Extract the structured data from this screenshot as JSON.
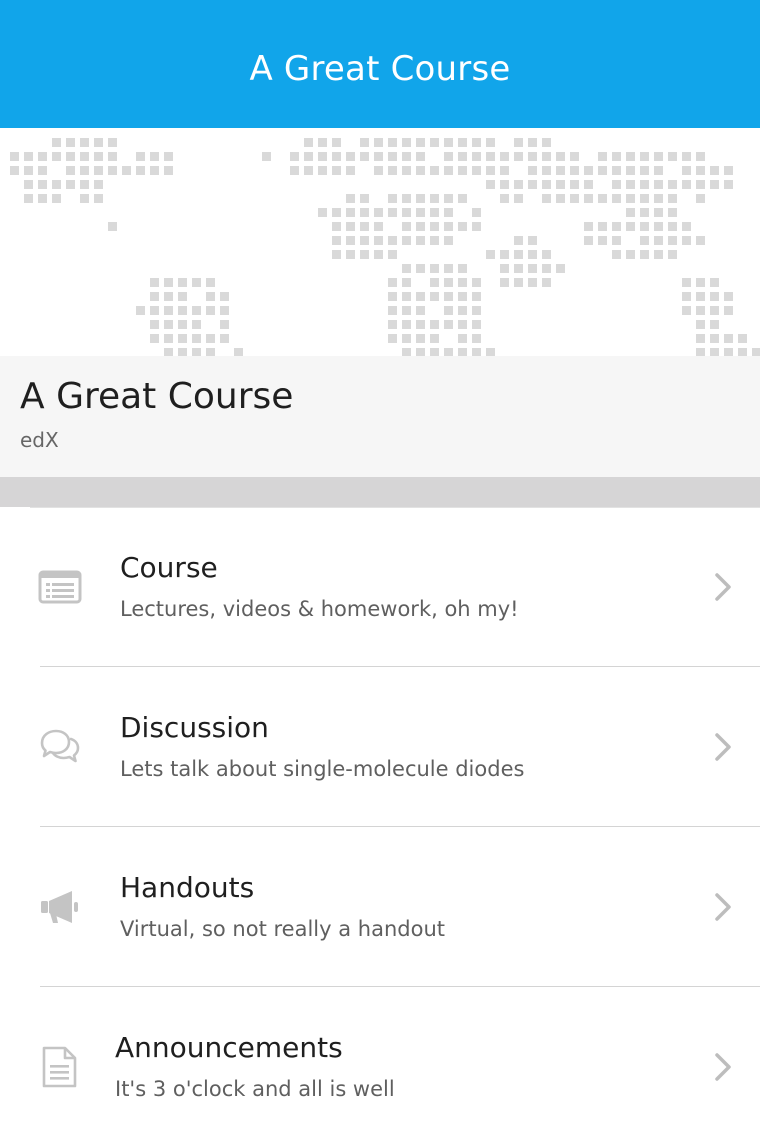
{
  "nav": {
    "title": "A Great Course"
  },
  "hero": {
    "image": "world-map-dots",
    "dot_color": "#d9d9d9"
  },
  "course": {
    "title": "A Great Course",
    "org": "edX"
  },
  "menu": {
    "items": [
      {
        "title": "Course",
        "subtitle": "Lectures, videos & homework, oh my!",
        "icon": "list-icon"
      },
      {
        "title": "Discussion",
        "subtitle": "Lets talk about single-molecule diodes",
        "icon": "chat-bubbles-icon"
      },
      {
        "title": "Handouts",
        "subtitle": "Virtual, so not really a handout",
        "icon": "megaphone-icon"
      },
      {
        "title": "Announcements",
        "subtitle": "It's 3 o'clock and all is well",
        "icon": "document-icon"
      }
    ]
  },
  "colors": {
    "nav_background": "#11a5ea",
    "header_background": "#f6f6f6",
    "separator": "#d6d5d6",
    "icon_gray": "#c4c4c4",
    "chevron_gray": "#bdbdbd"
  }
}
